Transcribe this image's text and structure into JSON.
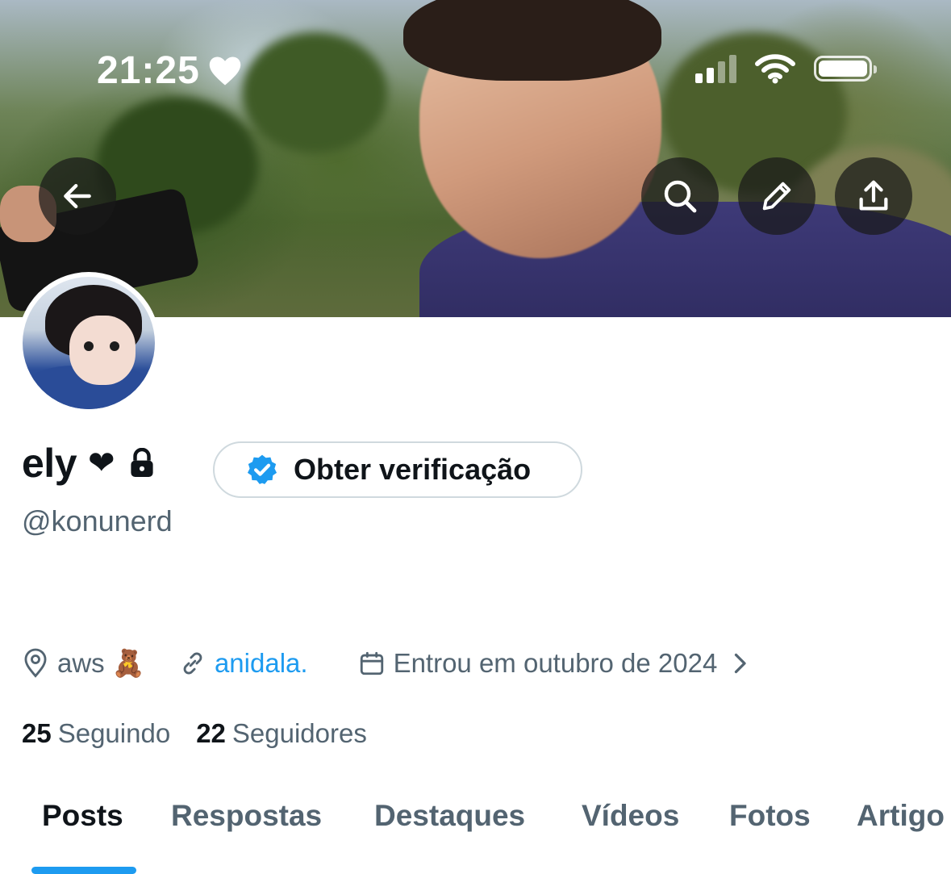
{
  "status_bar": {
    "time": "21:25",
    "time_icon": "heart-icon",
    "signal": "cellular-signal-icon",
    "wifi": "wifi-icon",
    "battery": "battery-icon"
  },
  "header_actions": [
    "back-arrow-icon",
    "search-icon",
    "pencil-icon",
    "share-icon"
  ],
  "profile": {
    "name": "ely",
    "name_emoji": "❤",
    "locked_icon": "lock-icon",
    "verify_button_label": "Obter verificação",
    "handle": "@konunerd",
    "location": "aws 🧸",
    "website": "anidala.",
    "joined": "Entrou em outubro de 2024",
    "following_count": "25",
    "following_label": "Seguindo",
    "followers_count": "22",
    "followers_label": "Seguidores"
  },
  "tabs": [
    {
      "label": "Posts",
      "active": true
    },
    {
      "label": "Respostas",
      "active": false
    },
    {
      "label": "Destaques",
      "active": false
    },
    {
      "label": "Vídeos",
      "active": false
    },
    {
      "label": "Fotos",
      "active": false
    },
    {
      "label": "Artigo",
      "active": false
    }
  ],
  "colors": {
    "accent": "#1d9bf0",
    "text": "#0f1419",
    "secondary": "#536471",
    "border": "#cfd9de"
  }
}
